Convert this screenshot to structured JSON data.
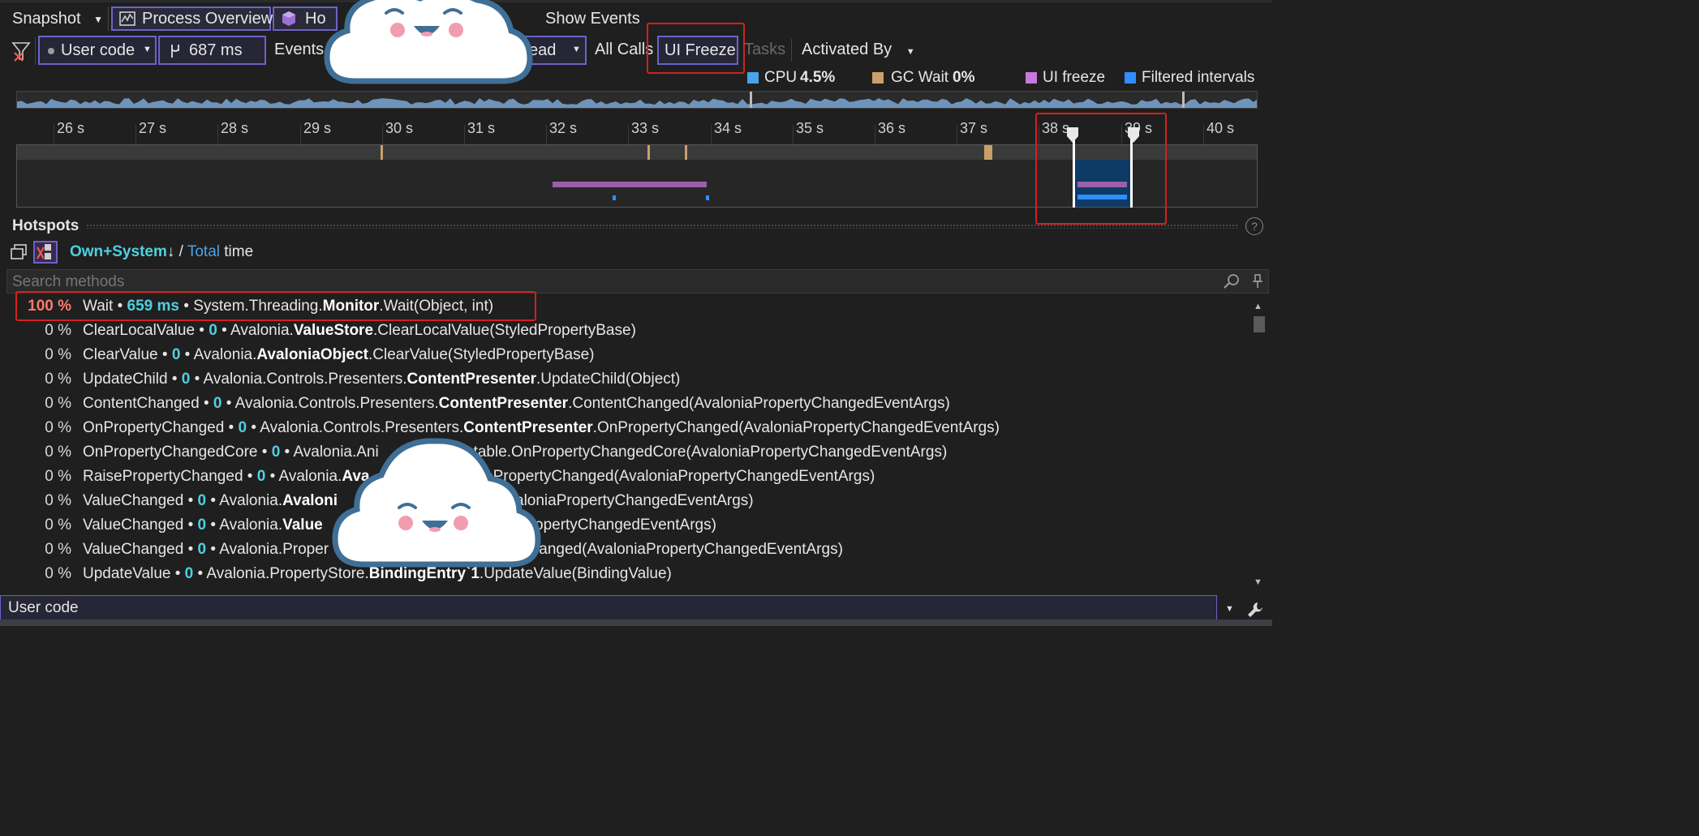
{
  "toolbar": {
    "snapshot_label": "Snapshot",
    "process_overview_label": "Process Overview",
    "hotspots_tab_label": "Ho",
    "show_events_label": "Show Events"
  },
  "filters": {
    "user_code_label": "User code",
    "duration_label": "687 ms",
    "events_label": "Events",
    "thread_label": "ead",
    "all_calls_label": "All Calls",
    "ui_freeze_label": "UI Freeze",
    "tasks_label": "Tasks",
    "activated_by_label": "Activated By"
  },
  "legend": {
    "cpu_label": "CPU",
    "cpu_value": "4.5%",
    "gc_label": "GC Wait",
    "gc_value": "0%",
    "ui_freeze_label": "UI freeze",
    "filtered_label": "Filtered intervals",
    "colors": {
      "cpu": "#4aa3e8",
      "gc": "#c9a06a",
      "ui_freeze": "#c678dd",
      "filtered": "#2f8fff"
    }
  },
  "timeline": {
    "ticks": [
      "26 s",
      "27 s",
      "28 s",
      "29 s",
      "30 s",
      "31 s",
      "32 s",
      "33 s",
      "34 s",
      "35 s",
      "36 s",
      "37 s",
      "38 s",
      "39 s",
      "40 s"
    ]
  },
  "hotspots": {
    "title": "Hotspots",
    "sort_own": "Own+System",
    "sort_arrow": "↓",
    "sort_slash": " / ",
    "sort_total": "Total",
    "sort_time": " time",
    "search_placeholder": "Search methods",
    "rows": [
      {
        "pct": "100 %",
        "name": "Wait",
        "ms": "659 ms",
        "ns": "System.Threading.",
        "cls": "Monitor",
        "sig": ".Wait(Object, int)"
      },
      {
        "pct": "0 %",
        "name": "ClearLocalValue",
        "ms": "0",
        "ns": "Avalonia.",
        "cls": "ValueStore",
        "sig": ".ClearLocalValue(StyledPropertyBase)"
      },
      {
        "pct": "0 %",
        "name": "ClearValue",
        "ms": "0",
        "ns": "Avalonia.",
        "cls": "AvaloniaObject",
        "sig": ".ClearValue(StyledPropertyBase)"
      },
      {
        "pct": "0 %",
        "name": "UpdateChild",
        "ms": "0",
        "ns": "Avalonia.Controls.Presenters.",
        "cls": "ContentPresenter",
        "sig": ".UpdateChild(Object)"
      },
      {
        "pct": "0 %",
        "name": "ContentChanged",
        "ms": "0",
        "ns": "Avalonia.Controls.Presenters.",
        "cls": "ContentPresenter",
        "sig": ".ContentChanged(AvaloniaPropertyChangedEventArgs)"
      },
      {
        "pct": "0 %",
        "name": "OnPropertyChanged",
        "ms": "0",
        "ns": "Avalonia.Controls.Presenters.",
        "cls": "ContentPresenter",
        "sig": ".OnPropertyChanged(AvaloniaPropertyChangedEventArgs)"
      },
      {
        "pct": "0 %",
        "name": "OnPropertyChangedCore",
        "ms": "0",
        "ns": "Avalonia.Ani",
        "cls": "",
        "sig": "",
        "tail": "atable.OnPropertyChangedCore(AvaloniaPropertyChangedEventArgs)"
      },
      {
        "pct": "0 %",
        "name": "RaisePropertyChanged",
        "ms": "0",
        "ns": "Avalonia.",
        "cls": "Ava",
        "sig": "",
        "tail": "ePropertyChanged(AvaloniaPropertyChangedEventArgs)"
      },
      {
        "pct": "0 %",
        "name": "ValueChanged",
        "ms": "0",
        "ns": "Avalonia.",
        "cls": "Avaloni",
        "sig": "",
        "tail": "aloniaPropertyChangedEventArgs)"
      },
      {
        "pct": "0 %",
        "name": "ValueChanged",
        "ms": "0",
        "ns": "Avalonia.",
        "cls": "Value",
        "sig": "",
        "tail": "PropertyChangedEventArgs)"
      },
      {
        "pct": "0 %",
        "name": "ValueChanged",
        "ms": "0",
        "ns": "Avalonia.Proper",
        "cls": "",
        "sig": "",
        "tail": "Changed(AvaloniaPropertyChangedEventArgs)"
      },
      {
        "pct": "0 %",
        "name": "UpdateValue",
        "ms": "0",
        "ns": "Avalonia.PropertyStore.",
        "cls": "BindingEntry`1",
        "sig": ".UpdateValue(BindingValue)"
      }
    ]
  },
  "bottom": {
    "field_value": "User code"
  }
}
